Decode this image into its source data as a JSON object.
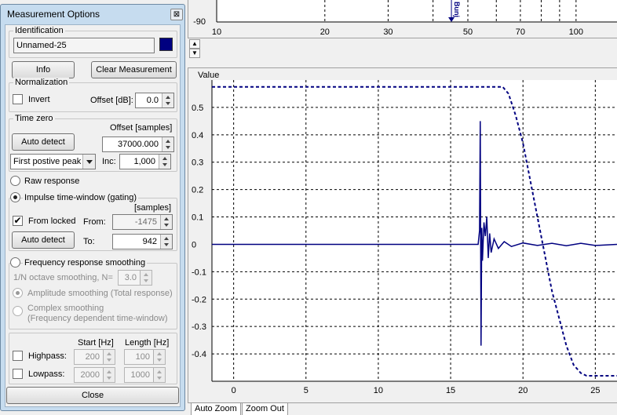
{
  "window": {
    "title": "Measurement Options",
    "close_glyph": "⊠"
  },
  "identification": {
    "legend": "Identification",
    "name": "Unnamed-25",
    "color": "#000080"
  },
  "buttons": {
    "info": "Info",
    "clear": "Clear Measurement",
    "close": "Close"
  },
  "normalization": {
    "legend": "Normalization",
    "invert_label": "Invert",
    "invert_checked": false,
    "offset_label": "Offset [dB]:",
    "offset_value": "0.0"
  },
  "time_zero": {
    "legend": "Time zero",
    "offset_label": "Offset [samples]",
    "auto_detect": "Auto detect",
    "offset_value": "37000.000",
    "mode": "First postive peak",
    "inc_label": "Inc:",
    "inc_value": "1,000"
  },
  "raw_response": {
    "label": "Raw response",
    "selected": false
  },
  "gating": {
    "label": "Impulse time-window (gating)",
    "selected": true,
    "unit_label": "[samples]",
    "from_locked_label": "From locked",
    "from_locked_checked": true,
    "from_label": "From:",
    "from_value": "-1475",
    "auto_detect": "Auto detect",
    "to_label": "To:",
    "to_value": "942"
  },
  "smoothing": {
    "label": "Frequency response smoothing",
    "selected": false,
    "octave_label": "1/N octave smoothing, N=",
    "octave_value": "3.0",
    "amplitude_label": "Amplitude smoothing (Total response)",
    "amplitude_selected": true,
    "complex_label_1": "Complex smoothing",
    "complex_label_2": "(Frequency dependent time-window)"
  },
  "filters": {
    "start_header": "Start [Hz]",
    "length_header": "Length [Hz]",
    "highpass_label": "Highpass:",
    "highpass_checked": false,
    "highpass_start": "200",
    "highpass_length": "100",
    "lowpass_label": "Lowpass:",
    "lowpass_checked": false,
    "lowpass_start": "2000",
    "lowpass_length": "1000"
  },
  "tabs": {
    "auto_zoom": "Auto Zoom",
    "zoom_out": "Zoom Out"
  },
  "marker": {
    "label": "Bunj"
  },
  "chart_data": [
    {
      "type": "line",
      "xscale": "log",
      "xlim": [
        10,
        130
      ],
      "x_ticks": [
        10,
        20,
        30,
        40,
        50,
        60,
        70,
        80,
        90,
        100
      ],
      "x_tick_labels": [
        "10",
        "20",
        "30",
        "50",
        "70",
        "100"
      ],
      "y_tick_labels": [
        "-90"
      ],
      "marker_x": 45
    },
    {
      "type": "line",
      "ylabel": "Value",
      "xlim": [
        -1.5,
        26.5
      ],
      "ylim": [
        -0.5,
        0.6
      ],
      "x_ticks": [
        0,
        5,
        10,
        15,
        20,
        25
      ],
      "y_ticks": [
        0.5,
        0.4,
        0.3,
        0.2,
        0.1,
        0,
        -0.1,
        -0.2,
        -0.3,
        -0.4
      ],
      "x_tick_labels": [
        "0",
        "5",
        "10",
        "15",
        "20",
        "25"
      ],
      "y_tick_labels": [
        "0.5",
        "0.4",
        "0.3",
        "0.2",
        "0.1",
        "0",
        "-0.1",
        "-0.2",
        "-0.3",
        "-0.4"
      ],
      "series": [
        {
          "style": "dashed",
          "color": "#000080",
          "x": [
            -1.5,
            18.6,
            19.0,
            19.5,
            20.0,
            21.0,
            22.0,
            23.0,
            23.5,
            24.0,
            24.4,
            26.5
          ],
          "y": [
            0.575,
            0.575,
            0.55,
            0.47,
            0.37,
            0.1,
            -0.17,
            -0.37,
            -0.44,
            -0.47,
            -0.48,
            -0.48
          ]
        },
        {
          "style": "solid",
          "color": "#000080",
          "x": [
            -1.5,
            16.9,
            17.0,
            17.05,
            17.1,
            17.15,
            17.2,
            17.3,
            17.4,
            17.5,
            17.6,
            17.7,
            17.8,
            18.0,
            18.3,
            18.7,
            19.2,
            20.0,
            21.0,
            22.0,
            23.0,
            24.0,
            25.0,
            26.5
          ],
          "y": [
            0,
            0,
            0.05,
            0.45,
            -0.37,
            0.06,
            -0.06,
            0.08,
            0.03,
            0.1,
            -0.05,
            0.04,
            -0.03,
            0.02,
            -0.015,
            0.01,
            -0.008,
            0.005,
            -0.004,
            0.004,
            -0.005,
            0.004,
            -0.004,
            0.0
          ]
        }
      ]
    }
  ]
}
